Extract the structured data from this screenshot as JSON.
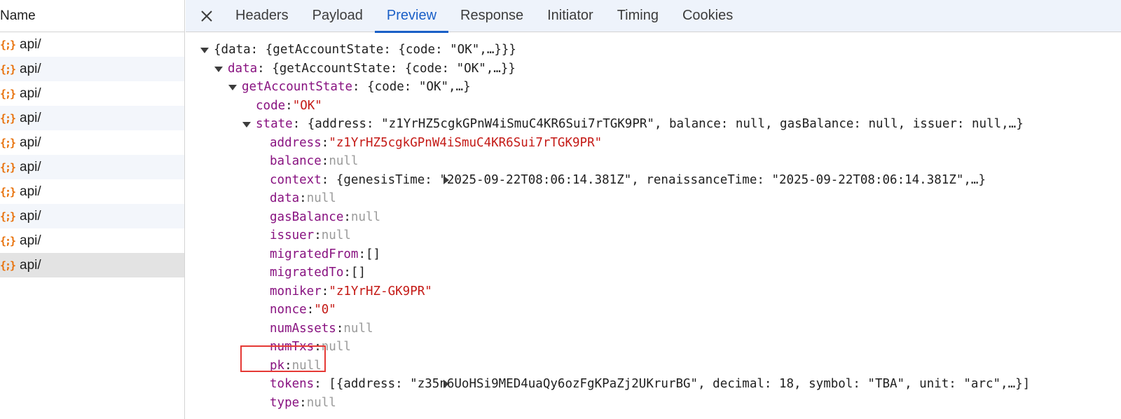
{
  "left_panel": {
    "header": "Name",
    "items": [
      "api/",
      "api/",
      "api/",
      "api/",
      "api/",
      "api/",
      "api/",
      "api/",
      "api/",
      "api/"
    ],
    "icon": "json-braces-icon"
  },
  "tabs": {
    "close_icon": "close-icon",
    "items": [
      "Headers",
      "Payload",
      "Preview",
      "Response",
      "Initiator",
      "Timing",
      "Cookies"
    ],
    "active": "Preview"
  },
  "preview": {
    "root_summary": "{data: {getAccountState: {code: \"OK\",…}}}",
    "data_key": "data",
    "data_summary": ": {getAccountState: {code: \"OK\",…}}",
    "gas_key": "getAccountState",
    "gas_summary": ": {code: \"OK\",…}",
    "code_key": "code",
    "code_val": "\"OK\"",
    "state_key": "state",
    "state_summary": ": {address: \"z1YrHZ5cgkGPnW4iSmuC4KR6Sui7rTGK9PR\", balance: null, gasBalance: null, issuer: null,…}",
    "fields": {
      "address_key": "address",
      "address_val": "\"z1YrHZ5cgkGPnW4iSmuC4KR6Sui7rTGK9PR\"",
      "balance_key": "balance",
      "balance_val": "null",
      "context_key": "context",
      "context_summary": ": {genesisTime: \"2025-09-22T08:06:14.381Z\", renaissanceTime: \"2025-09-22T08:06:14.381Z\",…}",
      "data_key": "data",
      "data_val": "null",
      "gasBalance_key": "gasBalance",
      "gasBalance_val": "null",
      "issuer_key": "issuer",
      "issuer_val": "null",
      "migratedFrom_key": "migratedFrom",
      "migratedFrom_val": "[]",
      "migratedTo_key": "migratedTo",
      "migratedTo_val": "[]",
      "moniker_key": "moniker",
      "moniker_val": "\"z1YrHZ-GK9PR\"",
      "nonce_key": "nonce",
      "nonce_val": "\"0\"",
      "numAssets_key": "numAssets",
      "numAssets_val": "null",
      "numTxs_key": "numTxs",
      "numTxs_val": "null",
      "pk_key": "pk",
      "pk_val": "null",
      "tokens_key": "tokens",
      "tokens_summary": ": [{address: \"z35n6UoHSi9MED4uaQy6ozFgKPaZj2UKrurBG\", decimal: 18, symbol: \"TBA\", unit: \"arc\",…}]",
      "type_key": "type",
      "type_val": "null"
    }
  },
  "colors": {
    "active_tab": "#1a5fc7",
    "key": "#881280",
    "string": "#c41a16",
    "null": "#9a9a9a",
    "highlight_box": "#e53935",
    "json_icon": "#e8710a"
  }
}
